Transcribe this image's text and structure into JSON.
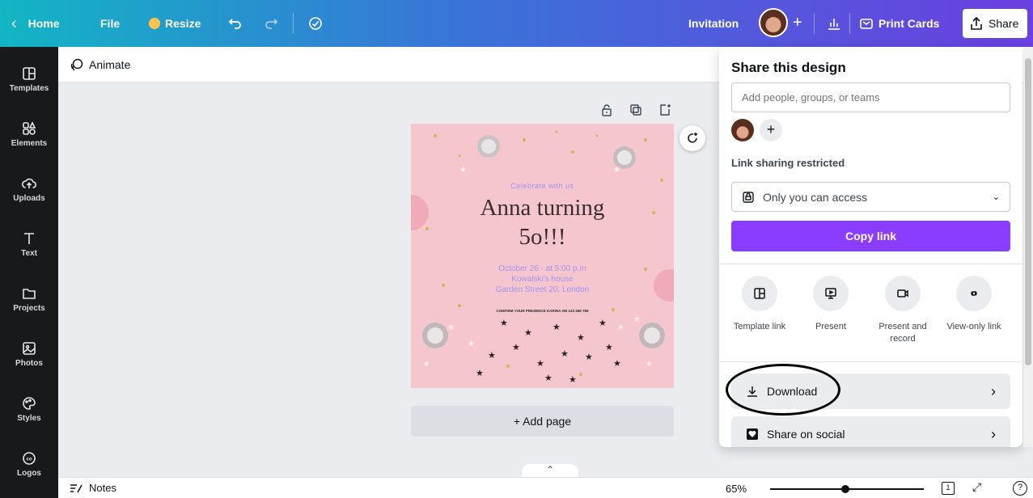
{
  "topbar": {
    "home": "Home",
    "file": "File",
    "resize": "Resize",
    "title": "Invitation",
    "print": "Print Cards",
    "share": "Share"
  },
  "sidebar": {
    "items": [
      {
        "label": "Templates"
      },
      {
        "label": "Elements"
      },
      {
        "label": "Uploads"
      },
      {
        "label": "Text"
      },
      {
        "label": "Projects"
      },
      {
        "label": "Photos"
      },
      {
        "label": "Styles"
      },
      {
        "label": "Logos"
      }
    ]
  },
  "toolbar": {
    "animate": "Animate"
  },
  "design": {
    "subtitle": "Celebrate with us",
    "title_line1": "Anna turning",
    "title_line2": "5o!!!",
    "details": [
      "October 26 - at 5:00 p.m",
      "Kowalski's house",
      "Garden Street 20, London"
    ],
    "confirm": "CONFIRM YOUR PRESENCE KARINA ON 123 456 789"
  },
  "add_page": "+ Add page",
  "bottom": {
    "notes": "Notes",
    "zoom": "65%",
    "page_num": "1"
  },
  "share_panel": {
    "title": "Share this design",
    "input_placeholder": "Add people, groups, or teams",
    "link_label": "Link sharing restricted",
    "access_value": "Only you can access",
    "copy_button": "Copy link",
    "options": [
      {
        "label": "Template link",
        "icon": "template-icon"
      },
      {
        "label": "Present",
        "icon": "present-icon"
      },
      {
        "label": "Present and record",
        "icon": "record-icon"
      },
      {
        "label": "View-only link",
        "icon": "link-icon"
      }
    ],
    "download": "Download",
    "social": "Share on social"
  },
  "colors": {
    "accent": "#8b3dff",
    "topbar_start": "#12b5c4",
    "topbar_end": "#6b3fe0",
    "design_bg": "#f6c6cf",
    "design_text": "#a98ff0"
  }
}
